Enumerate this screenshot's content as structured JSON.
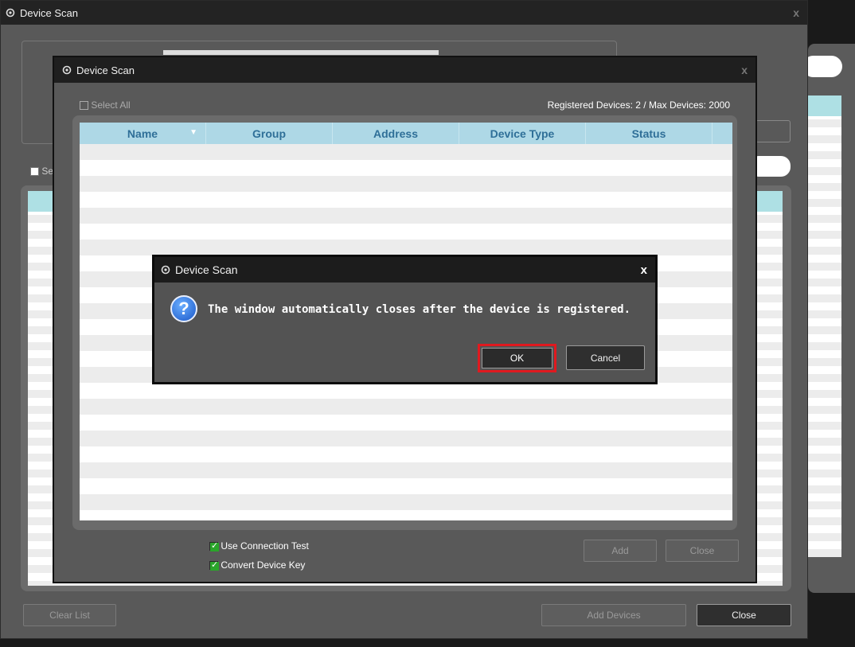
{
  "main_window": {
    "title": "Device Scan",
    "select_all_label": "Se",
    "clear_list_label": "Clear List",
    "add_devices_label": "Add Devices",
    "close_label": "Close"
  },
  "scan_window": {
    "title": "Device Scan",
    "select_all_label": "Select All",
    "registered_info": "Registered Devices: 2 / Max Devices: 2000",
    "columns": [
      "Name",
      "Group",
      "Address",
      "Device Type",
      "Status"
    ],
    "use_connection_test_label": "Use Connection Test",
    "use_connection_test_checked": true,
    "convert_device_key_label": "Convert Device Key",
    "convert_device_key_checked": true,
    "add_label": "Add",
    "close_label": "Close"
  },
  "dialog": {
    "title": "Device Scan",
    "close_glyph": "x",
    "message": "The window automatically closes after the device is registered.",
    "question_glyph": "?",
    "ok_label": "OK",
    "cancel_label": "Cancel",
    "highlight_color": "#e0191f"
  },
  "icons": {
    "title_icon": "gear-icon",
    "sort_icon": "triangle-down-icon"
  }
}
